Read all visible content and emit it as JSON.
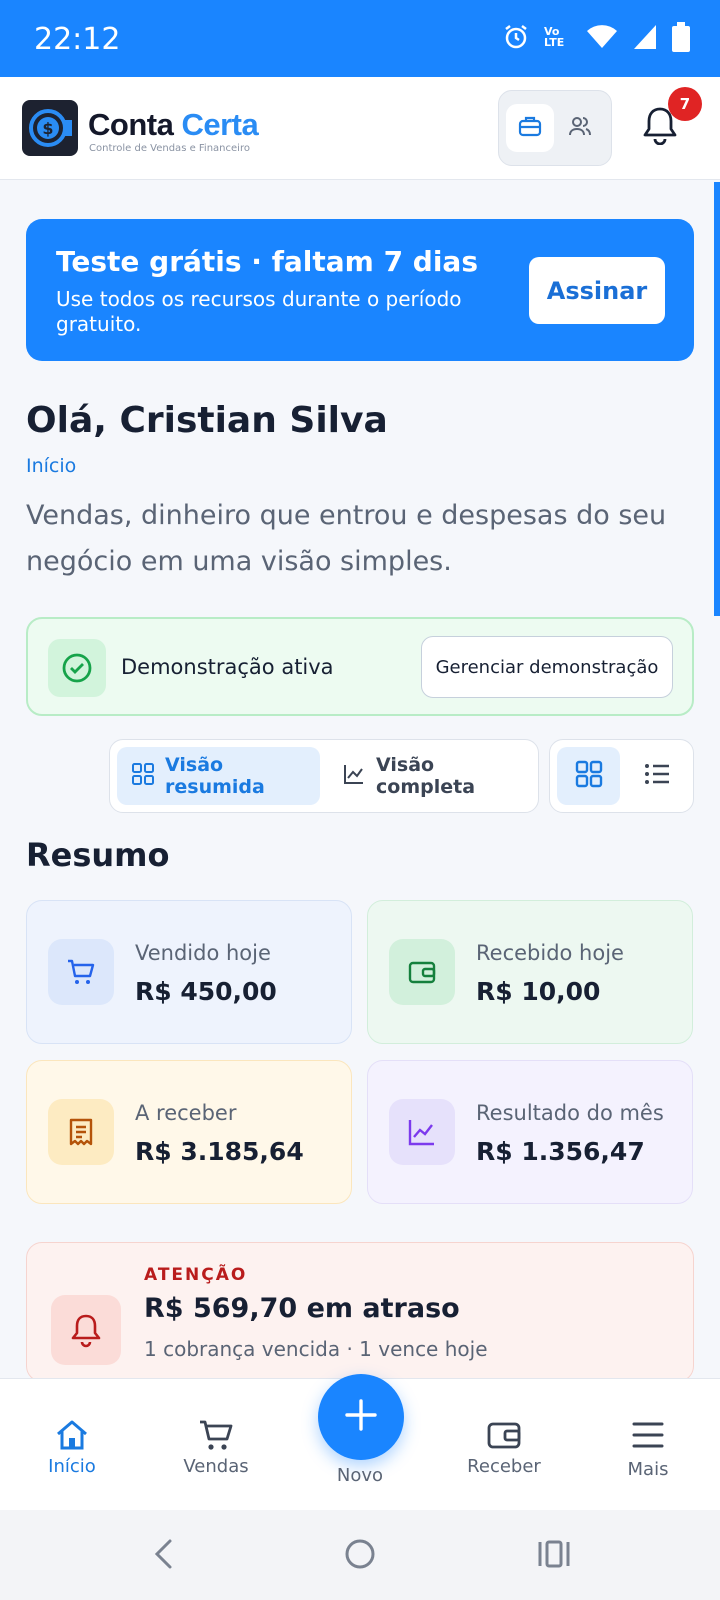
{
  "status_bar": {
    "time": "22:12",
    "network": "Vo LTE"
  },
  "header": {
    "brand_part1": "Conta",
    "brand_part2": "Certa",
    "brand_subtitle": "Controle de Vendas e Financeiro",
    "notification_count": "7"
  },
  "trial": {
    "title": "Teste grátis · faltam 7 dias",
    "description": "Use todos os recursos durante o período gratuito.",
    "button": "Assinar"
  },
  "greeting": "Olá, Cristian Silva",
  "breadcrumb": "Início",
  "intro": "Vendas, dinheiro que entrou e despesas do seu negócio em uma visão simples.",
  "demo": {
    "label": "Demonstração ativa",
    "button": "Gerenciar demonstração"
  },
  "view_toggle": {
    "summary": "Visão resumida",
    "full": "Visão completa"
  },
  "summary_title": "Resumo",
  "cards": [
    {
      "label": "Vendido hoje",
      "value": "R$ 450,00"
    },
    {
      "label": "Recebido hoje",
      "value": "R$ 10,00"
    },
    {
      "label": "A receber",
      "value": "R$ 3.185,64"
    },
    {
      "label": "Resultado do mês",
      "value": "R$ 1.356,47"
    }
  ],
  "alert": {
    "kicker": "ATENÇÃO",
    "title": "R$ 569,70 em atraso",
    "subtitle": "1 cobrança vencida · 1 vence hoje"
  },
  "bottom_nav": [
    {
      "label": "Início"
    },
    {
      "label": "Vendas"
    },
    {
      "label": "Novo"
    },
    {
      "label": "Receber"
    },
    {
      "label": "Mais"
    }
  ],
  "colors": {
    "primary": "#1a85ff",
    "alert": "#b91c1c",
    "success": "#16a34a"
  }
}
